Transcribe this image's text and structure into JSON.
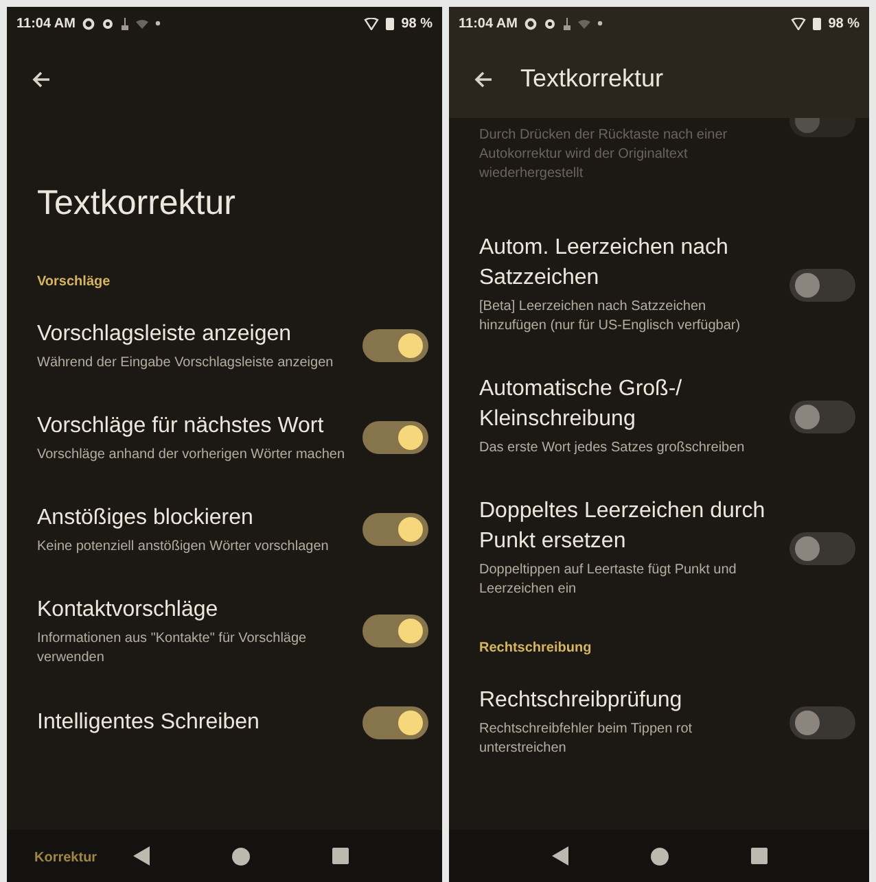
{
  "screens": [
    {
      "status_bar": {
        "time": "11:04 AM",
        "battery": "98 %"
      },
      "app_bar": {
        "collapsed": false
      },
      "large_title": "Textkorrektur",
      "items": [
        {
          "kind": "header",
          "title": "Vorschläge"
        },
        {
          "kind": "switch",
          "title": "Vorschlagsleiste anzeigen",
          "description": "Während der Eingabe Vorschlagsleiste anzeigen",
          "on": true
        },
        {
          "kind": "switch",
          "title": "Vorschläge für nächstes Wort",
          "description": "Vorschläge anhand der vorherigen Wörter machen",
          "on": true
        },
        {
          "kind": "switch",
          "title": "Anstößiges blockieren",
          "description": "Keine potenziell anstößigen Wörter vorschlagen",
          "on": true
        },
        {
          "kind": "switch",
          "title": "Kontaktvorschläge",
          "description": "Informationen aus \"Kontakte\" für Vorschläge verwenden",
          "on": true
        },
        {
          "kind": "switch",
          "title": "Intelligentes Schreiben",
          "on": true
        }
      ],
      "footer_header": "Korrektur"
    },
    {
      "status_bar": {
        "time": "11:04 AM",
        "battery": "98 %"
      },
      "app_bar": {
        "title": "Textkorrektur",
        "collapsed": true
      },
      "items": [
        {
          "kind": "switch",
          "description": "Durch Drücken der Rücktaste nach einer Autokorrektur wird der Originaltext wiederhergestellt",
          "on": false,
          "cut": true
        },
        {
          "kind": "switch",
          "title": "Autom. Leerzeichen nach Satzzeichen",
          "description": "[Beta] Leerzeichen nach Satzzeichen hinzufügen (nur für US-Englisch verfügbar)",
          "on": false
        },
        {
          "kind": "switch",
          "title": "Automatische Groß-/ Kleinschreibung",
          "description": "Das erste Wort jedes Satzes großschreiben",
          "on": false
        },
        {
          "kind": "switch",
          "title": "Doppeltes Leerzeichen durch Punkt ersetzen",
          "description": "Doppeltippen auf Leertaste fügt Punkt und Leerzeichen ein",
          "on": false
        },
        {
          "kind": "header",
          "title": "Rechtschreibung"
        },
        {
          "kind": "switch",
          "title": "Rechtschreibprüfung",
          "description": "Rechtschreibfehler beim Tippen rot unterstreichen",
          "on": false
        }
      ]
    }
  ]
}
